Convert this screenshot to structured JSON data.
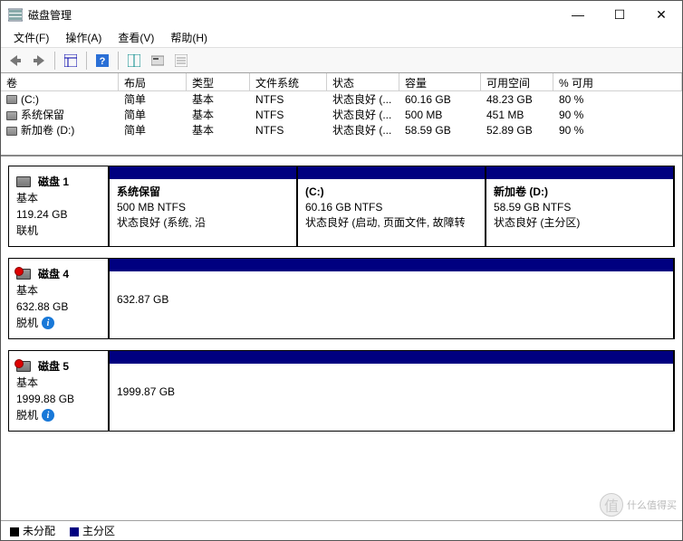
{
  "window": {
    "title": "磁盘管理"
  },
  "menu": {
    "file": "文件(F)",
    "action": "操作(A)",
    "view": "查看(V)",
    "help": "帮助(H)"
  },
  "headers": {
    "volume": "卷",
    "layout": "布局",
    "type": "类型",
    "fs": "文件系统",
    "status": "状态",
    "capacity": "容量",
    "free": "可用空间",
    "pct": "% 可用"
  },
  "volumes": [
    {
      "name": "(C:)",
      "layout": "简单",
      "type": "基本",
      "fs": "NTFS",
      "status": "状态良好 (...",
      "capacity": "60.16 GB",
      "free": "48.23 GB",
      "pct": "80 %"
    },
    {
      "name": "系统保留",
      "layout": "简单",
      "type": "基本",
      "fs": "NTFS",
      "status": "状态良好 (...",
      "capacity": "500 MB",
      "free": "451 MB",
      "pct": "90 %"
    },
    {
      "name": "新加卷 (D:)",
      "layout": "简单",
      "type": "基本",
      "fs": "NTFS",
      "status": "状态良好 (...",
      "capacity": "58.59 GB",
      "free": "52.89 GB",
      "pct": "90 %"
    }
  ],
  "disks": [
    {
      "name": "磁盘 1",
      "type": "基本",
      "size": "119.24 GB",
      "state": "联机",
      "err": false,
      "info": false,
      "parts": [
        {
          "title": "系统保留",
          "line2": "500 MB NTFS",
          "line3": "状态良好 (系统, 沿"
        },
        {
          "title": "(C:)",
          "line2": "60.16 GB NTFS",
          "line3": "状态良好 (启动, 页面文件, 故障转"
        },
        {
          "title": "新加卷  (D:)",
          "line2": "58.59 GB NTFS",
          "line3": "状态良好 (主分区)"
        }
      ]
    },
    {
      "name": "磁盘 4",
      "type": "基本",
      "size": "632.88 GB",
      "state": "脱机",
      "err": true,
      "info": true,
      "parts": [
        {
          "title": "",
          "line2": "632.87 GB",
          "line3": ""
        }
      ]
    },
    {
      "name": "磁盘 5",
      "type": "基本",
      "size": "1999.88 GB",
      "state": "脱机",
      "err": true,
      "info": true,
      "parts": [
        {
          "title": "",
          "line2": "1999.87 GB",
          "line3": ""
        }
      ]
    }
  ],
  "legend": {
    "unalloc": "未分配",
    "primary": "主分区"
  },
  "controls": {
    "min": "—",
    "max": "☐",
    "close": "✕"
  },
  "watermark": {
    "text": "什么值得买"
  }
}
